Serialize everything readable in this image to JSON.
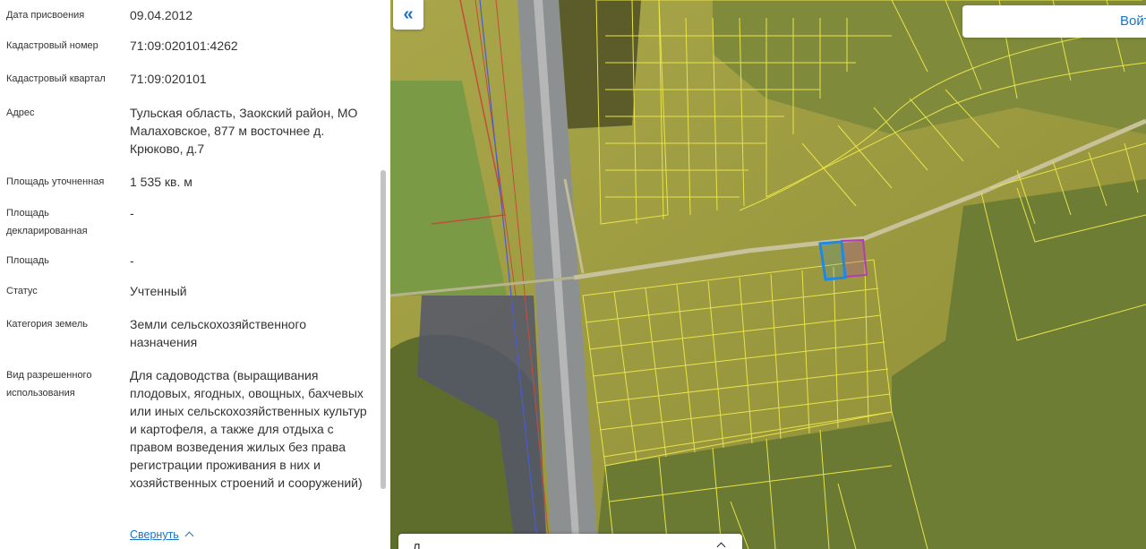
{
  "fields": [
    {
      "label": "Дата присвоения",
      "value": "09.04.2012"
    },
    {
      "label": "Кадастровый номер",
      "value": "71:09:020101:4262"
    },
    {
      "label": "Кадастровый квартал",
      "value": "71:09:020101"
    },
    {
      "label": "Адрес",
      "value": "Тульская область, Заокский район, МО Малаховское, 877 м восточнее д. Крюково, д.7"
    },
    {
      "label": "Площадь уточненная",
      "value": "1 535 кв. м"
    },
    {
      "label": "Площадь декларированная",
      "value": "-"
    },
    {
      "label": "Площадь",
      "value": "-"
    },
    {
      "label": "Статус",
      "value": "Учтенный"
    },
    {
      "label": "Категория земель",
      "value": "Земли сельскохозяйственного назначения"
    },
    {
      "label": "Вид разрешенного использования",
      "value": "Для садоводства (выращивания плодовых, ягодных, овощных, бахчевых или иных сельскохозяйственных культур и картофеля, а также для отдыха с правом возведения жилых без права регистрации проживания в них и хозяйственных строений и сооружений)"
    }
  ],
  "collapse_link": "Свернуть",
  "map": {
    "collapse_panel_icon": "«",
    "login_label": "Войти",
    "bottom_card_text": "Л",
    "parcel_outline_colors": {
      "parcel": "#e8e34a",
      "selected": "#1e88e5",
      "neighbor": "#b23bb8"
    }
  }
}
